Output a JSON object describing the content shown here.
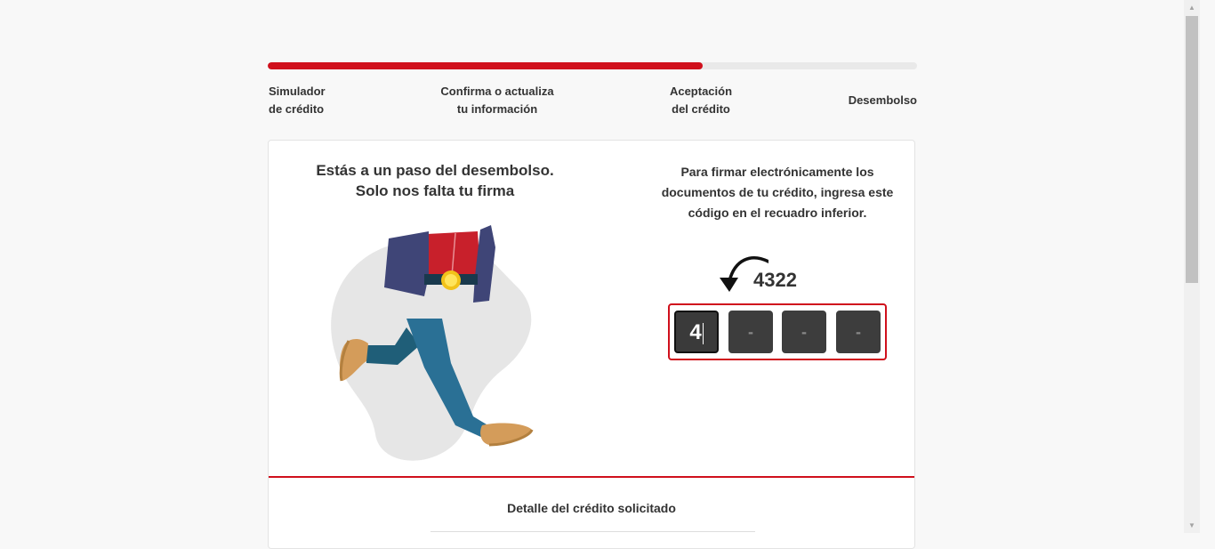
{
  "progress": {
    "value_percent": 67,
    "fill_color": "#d0101c"
  },
  "steps": [
    {
      "line1": "Simulador",
      "line2": "de crédito"
    },
    {
      "line1": "Confirma o actualiza",
      "line2": "tu información"
    },
    {
      "line1": "Aceptación",
      "line2": "del crédito"
    },
    {
      "line1": "Desembolso"
    }
  ],
  "card": {
    "title_line1": "Estás a un paso del desembolso.",
    "title_line2": "Solo nos falta tu firma",
    "instructions": "Para firmar electrónicamente los documentos de tu crédito, ingresa este código en el recuadro inferior.",
    "code": "4322",
    "digits": [
      "4",
      "-",
      "-",
      "-"
    ],
    "detail_title": "Detalle del crédito solicitado"
  },
  "icons": {
    "arrow": "curved-arrow-icon",
    "illustration": "walking-person-illustration",
    "scroll_up": "scroll-up-arrow-icon",
    "scroll_down": "scroll-down-arrow-icon"
  },
  "colors": {
    "accent": "#d0101c",
    "digit_bg": "#3d3d3d"
  }
}
